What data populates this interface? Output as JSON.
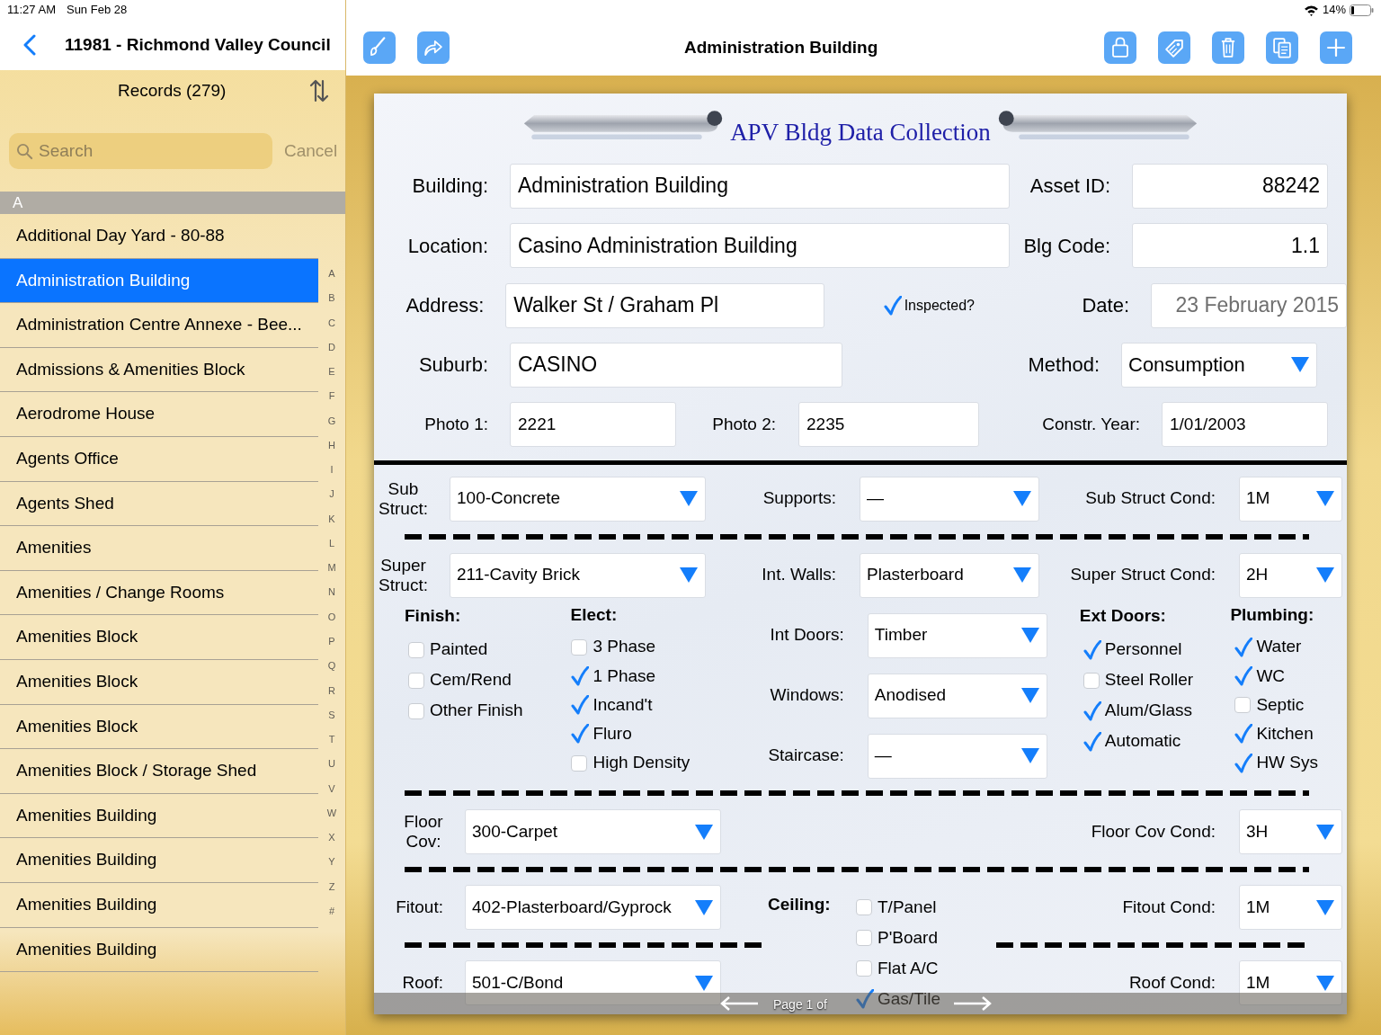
{
  "status_bar": {
    "time": "11:27 AM",
    "date": "Sun Feb 28",
    "battery": "14%"
  },
  "sidebar": {
    "title": "11981 - Richmond Valley Council",
    "records": "Records (279)",
    "search": {
      "placeholder": "Search"
    },
    "cancel": "Cancel",
    "section": "A",
    "items": [
      {
        "label": "Additional Day Yard - 80-88",
        "selected": false
      },
      {
        "label": "Administration Building",
        "selected": true
      },
      {
        "label": "Administration Centre Annexe - Bee...",
        "selected": false
      },
      {
        "label": "Admissions & Amenities Block",
        "selected": false
      },
      {
        "label": "Aerodrome House",
        "selected": false
      },
      {
        "label": "Agents Office",
        "selected": false
      },
      {
        "label": "Agents Shed",
        "selected": false
      },
      {
        "label": "Amenities",
        "selected": false
      },
      {
        "label": "Amenities / Change Rooms",
        "selected": false
      },
      {
        "label": "Amenities Block",
        "selected": false
      },
      {
        "label": "Amenities Block",
        "selected": false
      },
      {
        "label": "Amenities Block",
        "selected": false
      },
      {
        "label": "Amenities Block / Storage Shed",
        "selected": false
      },
      {
        "label": "Amenities Building",
        "selected": false
      },
      {
        "label": "Amenities Building",
        "selected": false
      },
      {
        "label": "Amenities Building",
        "selected": false
      },
      {
        "label": "Amenities Building",
        "selected": false
      }
    ],
    "index": [
      "A",
      "B",
      "C",
      "D",
      "E",
      "F",
      "G",
      "H",
      "I",
      "J",
      "K",
      "L",
      "M",
      "N",
      "O",
      "P",
      "Q",
      "R",
      "S",
      "T",
      "U",
      "V",
      "W",
      "X",
      "Y",
      "Z",
      "#"
    ]
  },
  "toolbar": {
    "title": "Administration Building"
  },
  "form": {
    "title": "APV Bldg Data Collection",
    "building": {
      "label": "Building:",
      "value": "Administration Building"
    },
    "asset_id": {
      "label": "Asset ID:",
      "value": "88242"
    },
    "location": {
      "label": "Location:",
      "value": "Casino Administration Building"
    },
    "blg_code": {
      "label": "Blg Code:",
      "value": "1.1"
    },
    "address": {
      "label": "Address:",
      "value": "Walker St / Graham Pl"
    },
    "inspected": {
      "label": "Inspected?",
      "checked": true
    },
    "date": {
      "label": "Date:",
      "value": "23 February 2015"
    },
    "suburb": {
      "label": "Suburb:",
      "value": "CASINO"
    },
    "method": {
      "label": "Method:",
      "value": "Consumption"
    },
    "photo_1": {
      "label": "Photo 1:",
      "value": "2221"
    },
    "photo_2": {
      "label": "Photo 2:",
      "value": "2235"
    },
    "constr_year": {
      "label": "Constr. Year:",
      "value": "1/01/2003"
    },
    "sub_struct": {
      "label": "Sub Struct:",
      "value": "100-Concrete"
    },
    "supports": {
      "label": "Supports:",
      "value": "—"
    },
    "sub_struct_cond": {
      "label": "Sub Struct Cond:",
      "value": "1M"
    },
    "super_struct": {
      "label": "Super Struct:",
      "value": "211-Cavity Brick"
    },
    "int_walls": {
      "label": "Int. Walls:",
      "value": "Plasterboard"
    },
    "super_struct_cond": {
      "label": "Super Struct Cond:",
      "value": "2H"
    },
    "finish": {
      "label": "Finish:",
      "options": [
        {
          "label": "Painted",
          "checked": false
        },
        {
          "label": "Cem/Rend",
          "checked": false
        },
        {
          "label": "Other Finish",
          "checked": false
        }
      ]
    },
    "elect": {
      "label": "Elect:",
      "options": [
        {
          "label": "3 Phase",
          "checked": false
        },
        {
          "label": "1 Phase",
          "checked": true
        },
        {
          "label": "Incand't",
          "checked": true
        },
        {
          "label": "Fluro",
          "checked": true
        },
        {
          "label": "High Density",
          "checked": false
        }
      ]
    },
    "int_doors": {
      "label": "Int Doors:",
      "value": "Timber"
    },
    "windows": {
      "label": "Windows:",
      "value": "Anodised"
    },
    "staircase": {
      "label": "Staircase:",
      "value": "—"
    },
    "ext_doors": {
      "label": "Ext Doors:",
      "options": [
        {
          "label": "Personnel",
          "checked": true
        },
        {
          "label": "Steel Roller",
          "checked": false
        },
        {
          "label": "Alum/Glass",
          "checked": true
        },
        {
          "label": "Automatic",
          "checked": true
        }
      ]
    },
    "plumbing": {
      "label": "Plumbing:",
      "options": [
        {
          "label": "Water",
          "checked": true
        },
        {
          "label": "WC",
          "checked": true
        },
        {
          "label": "Septic",
          "checked": false
        },
        {
          "label": "Kitchen",
          "checked": true
        },
        {
          "label": "HW Sys",
          "checked": true
        }
      ]
    },
    "floor_cov": {
      "label": "Floor Cov:",
      "value": "300-Carpet"
    },
    "floor_cov_cond": {
      "label": "Floor Cov Cond:",
      "value": "3H"
    },
    "fitout": {
      "label": "Fitout:",
      "value": "402-Plasterboard/Gyprock"
    },
    "ceiling": {
      "label": "Ceiling:",
      "options": [
        {
          "label": "T/Panel",
          "checked": false
        },
        {
          "label": "P'Board",
          "checked": false
        },
        {
          "label": "Flat A/C",
          "checked": false
        },
        {
          "label": "Gas/Tile",
          "checked": true
        }
      ]
    },
    "fitout_cond": {
      "label": "Fitout Cond:",
      "value": "1M"
    },
    "roof": {
      "label": "Roof:",
      "value": "501-C/Bond"
    },
    "roof_cond": {
      "label": "Roof Cond:",
      "value": "1M"
    }
  },
  "pager": {
    "label": "Page 1 of"
  }
}
